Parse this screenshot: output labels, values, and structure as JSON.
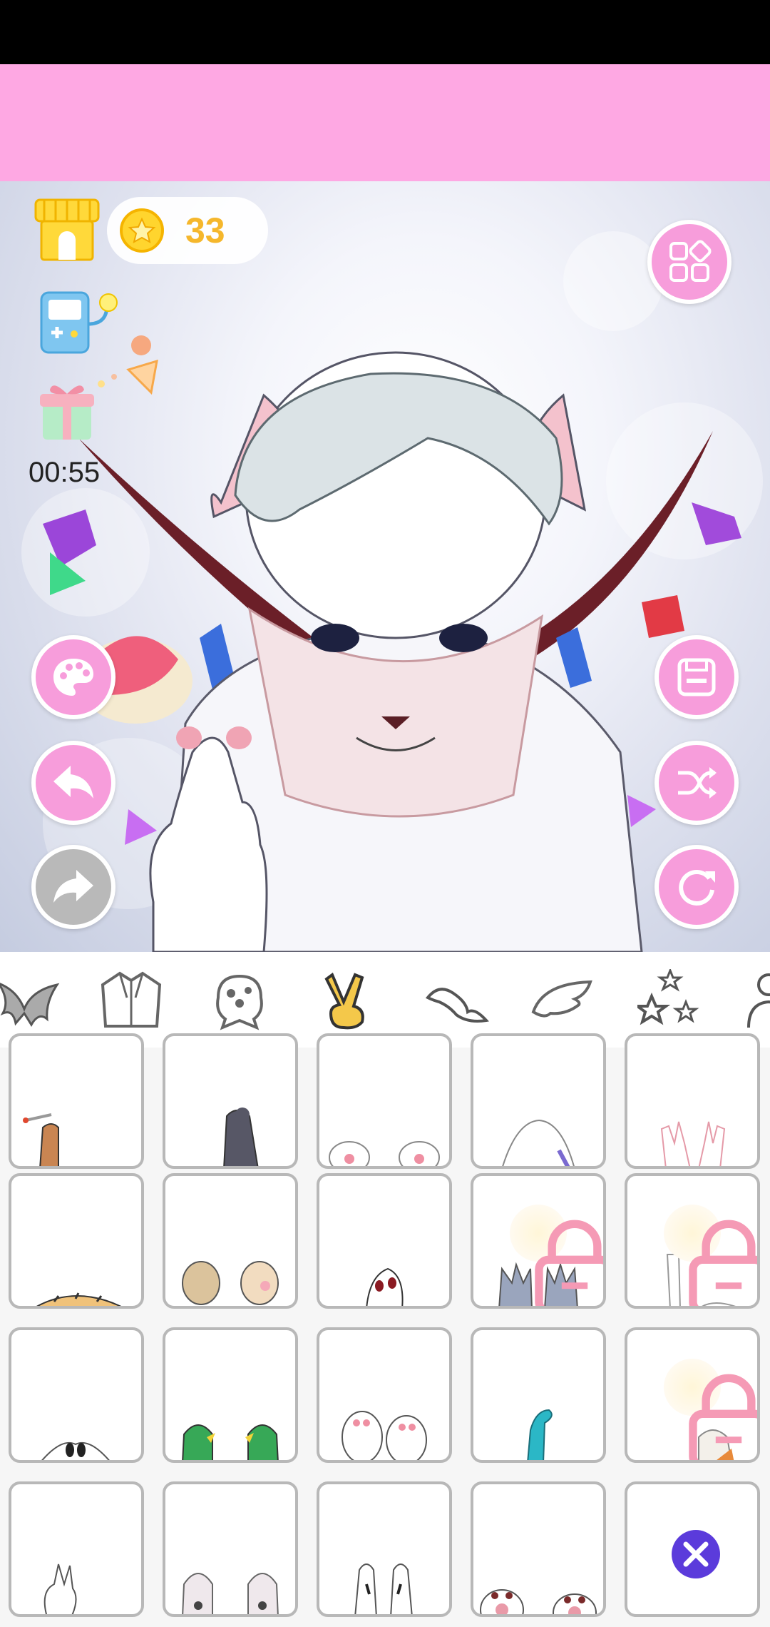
{
  "hud": {
    "coins": "33",
    "timer": "00:55"
  },
  "colors": {
    "accent_pink": "#f79ddb",
    "banner_pink": "#fea8e3",
    "coin_gold": "#f5b72c",
    "active_tab": "#f4c84a",
    "close_purple": "#5b3bdb"
  },
  "icons": {
    "top_left": [
      "shop-icon",
      "arcade-icon",
      "gift-icon"
    ],
    "left_buttons": [
      "palette-icon",
      "undo-icon",
      "redo-icon"
    ],
    "right_buttons": [
      "menu-grid-icon",
      "save-icon",
      "shuffle-icon",
      "reset-icon"
    ]
  },
  "category_tabs": [
    {
      "name": "ears",
      "active": false
    },
    {
      "name": "clothing",
      "active": false
    },
    {
      "name": "head-accessory",
      "active": false
    },
    {
      "name": "hands",
      "active": true
    },
    {
      "name": "tail",
      "active": false
    },
    {
      "name": "wings",
      "active": false
    },
    {
      "name": "effects",
      "active": false
    },
    {
      "name": "pose",
      "active": false
    }
  ],
  "items": [
    {
      "row": 0,
      "col": 0,
      "kind": "cigarette-hand",
      "locked": false
    },
    {
      "row": 0,
      "col": 1,
      "kind": "dark-paw-arm",
      "locked": false
    },
    {
      "row": 0,
      "col": 2,
      "kind": "pink-paws",
      "locked": false
    },
    {
      "row": 0,
      "col": 3,
      "kind": "heart-hands",
      "locked": false
    },
    {
      "row": 0,
      "col": 4,
      "kind": "raised-hands",
      "locked": false
    },
    {
      "row": 1,
      "col": 0,
      "kind": "tiger-arm",
      "locked": false
    },
    {
      "row": 1,
      "col": 1,
      "kind": "tan-paws",
      "locked": false
    },
    {
      "row": 1,
      "col": 2,
      "kind": "claw-hand",
      "locked": false
    },
    {
      "row": 1,
      "col": 3,
      "kind": "blue-claws",
      "locked": true
    },
    {
      "row": 1,
      "col": 4,
      "kind": "bandaged-hands",
      "locked": true
    },
    {
      "row": 2,
      "col": 0,
      "kind": "heart-gesture",
      "locked": false
    },
    {
      "row": 2,
      "col": 1,
      "kind": "green-paws",
      "locked": false
    },
    {
      "row": 2,
      "col": 2,
      "kind": "white-paws",
      "locked": false
    },
    {
      "row": 2,
      "col": 3,
      "kind": "teal-claw",
      "locked": false
    },
    {
      "row": 2,
      "col": 4,
      "kind": "wrapped-hand",
      "locked": true
    },
    {
      "row": 3,
      "col": 0,
      "kind": "peace-sign",
      "locked": false
    },
    {
      "row": 3,
      "col": 1,
      "kind": "grey-paws",
      "locked": false
    },
    {
      "row": 3,
      "col": 2,
      "kind": "talon-hands",
      "locked": false
    },
    {
      "row": 3,
      "col": 3,
      "kind": "paw-pads",
      "locked": false
    },
    {
      "row": 3,
      "col": 4,
      "kind": "close-icon",
      "locked": false
    }
  ]
}
